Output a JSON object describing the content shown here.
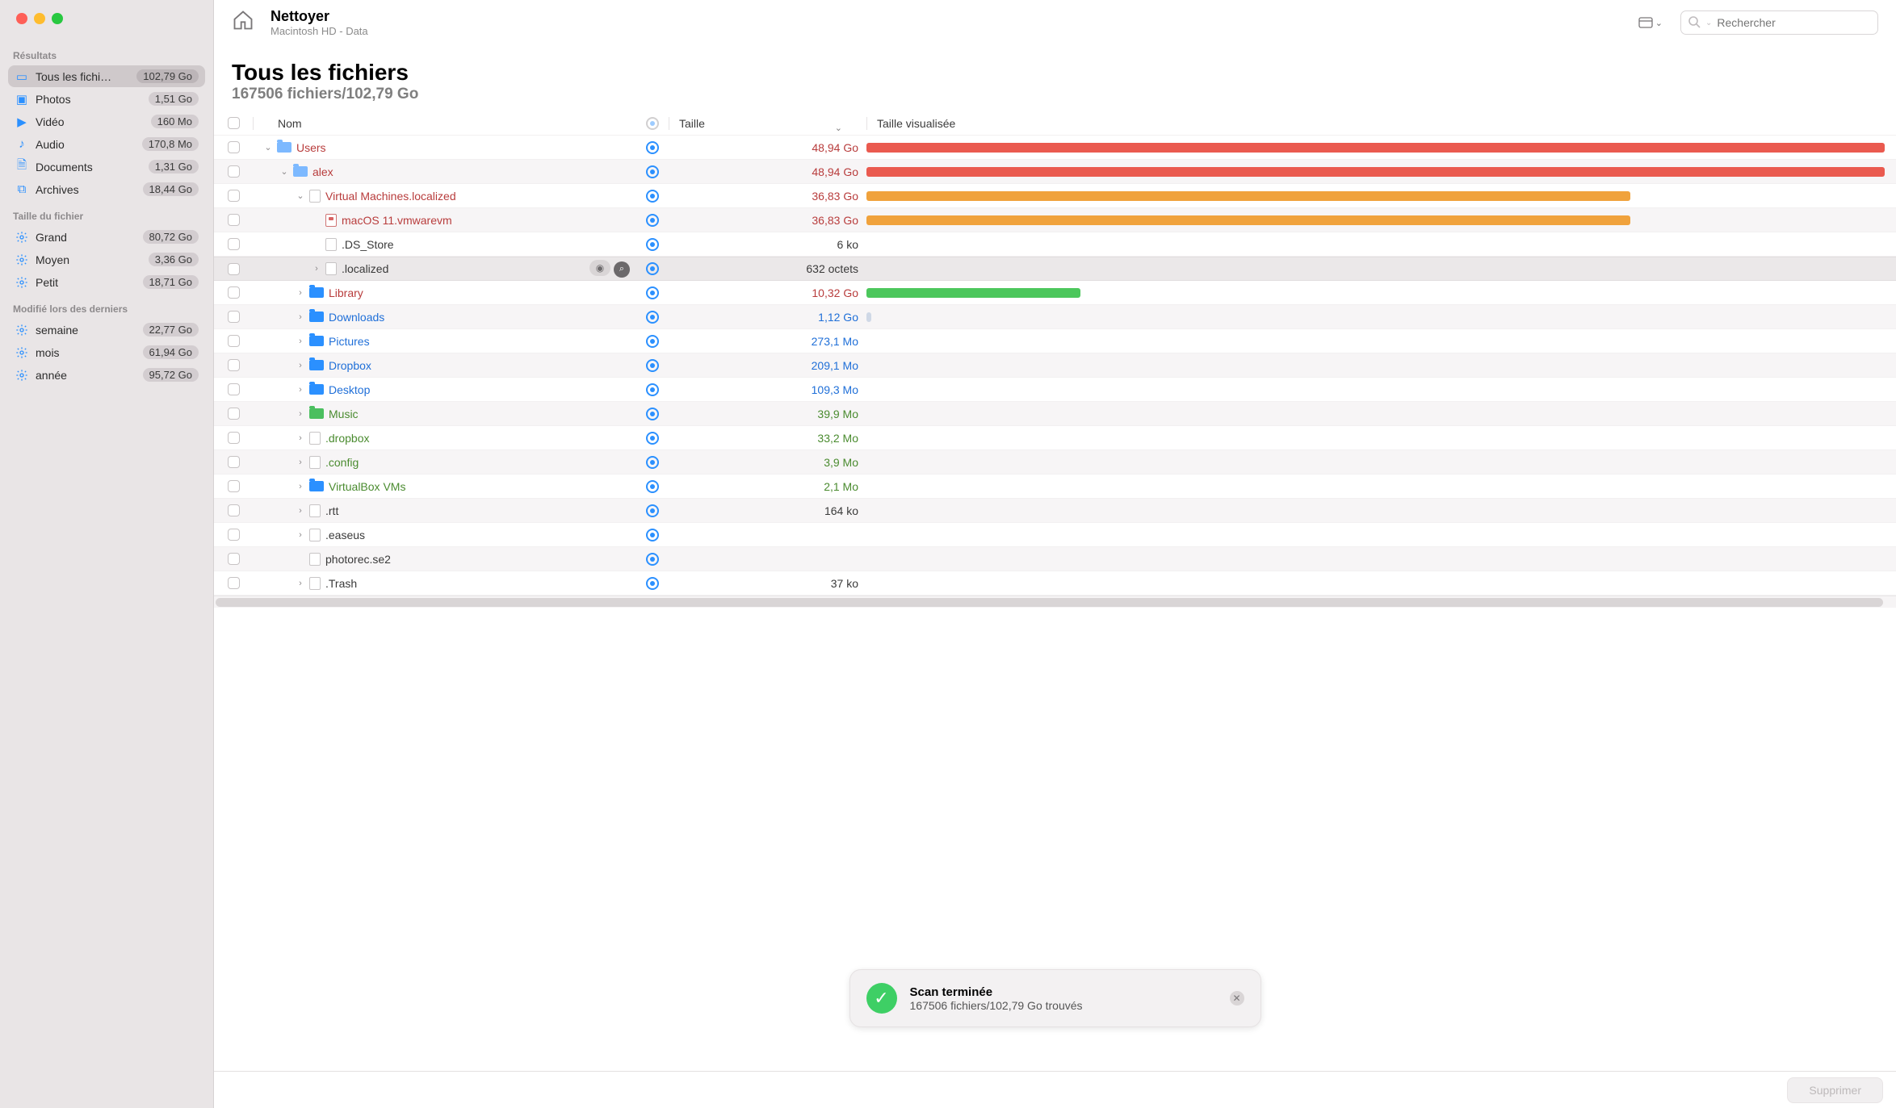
{
  "header": {
    "title": "Nettoyer",
    "subtitle": "Macintosh HD - Data",
    "search_placeholder": "Rechercher"
  },
  "page": {
    "title": "Tous les fichiers",
    "subtitle": "167506 fichiers/102,79 Go"
  },
  "columns": {
    "name": "Nom",
    "size": "Taille",
    "visual": "Taille visualisée"
  },
  "footer": {
    "delete": "Supprimer"
  },
  "toast": {
    "title": "Scan terminée",
    "subtitle": "167506 fichiers/102,79 Go trouvés"
  },
  "sidebar": {
    "sections": [
      {
        "title": "Résultats",
        "items": [
          {
            "icon": "files",
            "label": "Tous les fichi…",
            "badge": "102,79 Go",
            "active": true
          },
          {
            "icon": "photos",
            "label": "Photos",
            "badge": "1,51 Go"
          },
          {
            "icon": "video",
            "label": "Vidéo",
            "badge": "160 Mo"
          },
          {
            "icon": "audio",
            "label": "Audio",
            "badge": "170,8 Mo"
          },
          {
            "icon": "documents",
            "label": "Documents",
            "badge": "1,31 Go"
          },
          {
            "icon": "archives",
            "label": "Archives",
            "badge": "18,44 Go"
          }
        ]
      },
      {
        "title": "Taille du fichier",
        "items": [
          {
            "icon": "gear",
            "label": "Grand",
            "badge": "80,72 Go"
          },
          {
            "icon": "gear",
            "label": "Moyen",
            "badge": "3,36 Go"
          },
          {
            "icon": "gear",
            "label": "Petit",
            "badge": "18,71 Go"
          }
        ]
      },
      {
        "title": "Modifié lors des derniers",
        "items": [
          {
            "icon": "gear",
            "label": "semaine",
            "badge": "22,77 Go"
          },
          {
            "icon": "gear",
            "label": "mois",
            "badge": "61,94 Go"
          },
          {
            "icon": "gear",
            "label": "année",
            "badge": "95,72 Go"
          }
        ]
      }
    ]
  },
  "rows": [
    {
      "indent": 0,
      "disc": "down",
      "kind": "folder-light",
      "name": "Users",
      "size": "48,94 Go",
      "color": "#b83c3c",
      "bar": 100,
      "barColor": "#ea5a4f",
      "stripe": false
    },
    {
      "indent": 1,
      "disc": "down",
      "kind": "folder-light",
      "name": "alex",
      "size": "48,94 Go",
      "color": "#b83c3c",
      "bar": 100,
      "barColor": "#ea5a4f",
      "stripe": true
    },
    {
      "indent": 2,
      "disc": "down",
      "kind": "file",
      "name": "Virtual Machines.localized",
      "size": "36,83 Go",
      "color": "#b83c3c",
      "bar": 75,
      "barColor": "#f0a23c",
      "stripe": false
    },
    {
      "indent": 3,
      "disc": "none",
      "kind": "file-red",
      "name": "macOS 11.vmwarevm",
      "size": "36,83 Go",
      "color": "#b83c3c",
      "bar": 75,
      "barColor": "#f0a23c",
      "stripe": true
    },
    {
      "indent": 3,
      "disc": "none",
      "kind": "file",
      "name": ".DS_Store",
      "size": "6 ko",
      "color": "#3a3a3a",
      "bar": 0,
      "barColor": "",
      "stripe": false
    },
    {
      "indent": 3,
      "disc": "right",
      "kind": "file",
      "name": ".localized",
      "size": "632 octets",
      "color": "#3a3a3a",
      "bar": 0,
      "barColor": "",
      "stripe": false,
      "hover": true
    },
    {
      "indent": 2,
      "disc": "right",
      "kind": "folder",
      "name": "Library",
      "size": "10,32 Go",
      "color": "#b83c3c",
      "bar": 21,
      "barColor": "#4cc75c",
      "stripe": false
    },
    {
      "indent": 2,
      "disc": "right",
      "kind": "folder",
      "name": "Downloads",
      "size": "1,12 Go",
      "color": "#1f6fd8",
      "bar": 0.5,
      "barColor": "#cfd8e6",
      "stripe": true
    },
    {
      "indent": 2,
      "disc": "right",
      "kind": "folder",
      "name": "Pictures",
      "size": "273,1 Mo",
      "color": "#1f6fd8",
      "bar": 0,
      "barColor": "",
      "stripe": false
    },
    {
      "indent": 2,
      "disc": "right",
      "kind": "folder",
      "name": "Dropbox",
      "size": "209,1 Mo",
      "color": "#1f6fd8",
      "bar": 0,
      "barColor": "",
      "stripe": true
    },
    {
      "indent": 2,
      "disc": "right",
      "kind": "folder",
      "name": "Desktop",
      "size": "109,3 Mo",
      "color": "#1f6fd8",
      "bar": 0,
      "barColor": "",
      "stripe": false
    },
    {
      "indent": 2,
      "disc": "right",
      "kind": "folder-green",
      "name": "Music",
      "size": "39,9 Mo",
      "color": "#4a8b2f",
      "bar": 0,
      "barColor": "",
      "stripe": true
    },
    {
      "indent": 2,
      "disc": "right",
      "kind": "file",
      "name": ".dropbox",
      "size": "33,2 Mo",
      "color": "#4a8b2f",
      "bar": 0,
      "barColor": "",
      "stripe": false
    },
    {
      "indent": 2,
      "disc": "right",
      "kind": "file",
      "name": ".config",
      "size": "3,9 Mo",
      "color": "#4a8b2f",
      "bar": 0,
      "barColor": "",
      "stripe": true
    },
    {
      "indent": 2,
      "disc": "right",
      "kind": "folder",
      "name": "VirtualBox VMs",
      "size": "2,1 Mo",
      "color": "#4a8b2f",
      "bar": 0,
      "barColor": "",
      "stripe": false
    },
    {
      "indent": 2,
      "disc": "right",
      "kind": "file",
      "name": ".rtt",
      "size": "164 ko",
      "color": "#3a3a3a",
      "bar": 0,
      "barColor": "",
      "stripe": true
    },
    {
      "indent": 2,
      "disc": "right",
      "kind": "file",
      "name": ".easeus",
      "size": "",
      "color": "#3a3a3a",
      "bar": 0,
      "barColor": "",
      "stripe": false
    },
    {
      "indent": 2,
      "disc": "none",
      "kind": "file",
      "name": "photorec.se2",
      "size": "",
      "color": "#3a3a3a",
      "bar": 0,
      "barColor": "",
      "stripe": true
    },
    {
      "indent": 2,
      "disc": "right",
      "kind": "file",
      "name": ".Trash",
      "size": "37 ko",
      "color": "#3a3a3a",
      "bar": 0,
      "barColor": "",
      "stripe": false
    }
  ],
  "icons": {
    "files": "▭",
    "photos": "▣",
    "video": "▶",
    "audio": "♪",
    "documents": "📄",
    "archives": "⧉",
    "gear": "⚙"
  },
  "colors": {
    "blue": "#2b90ff"
  }
}
